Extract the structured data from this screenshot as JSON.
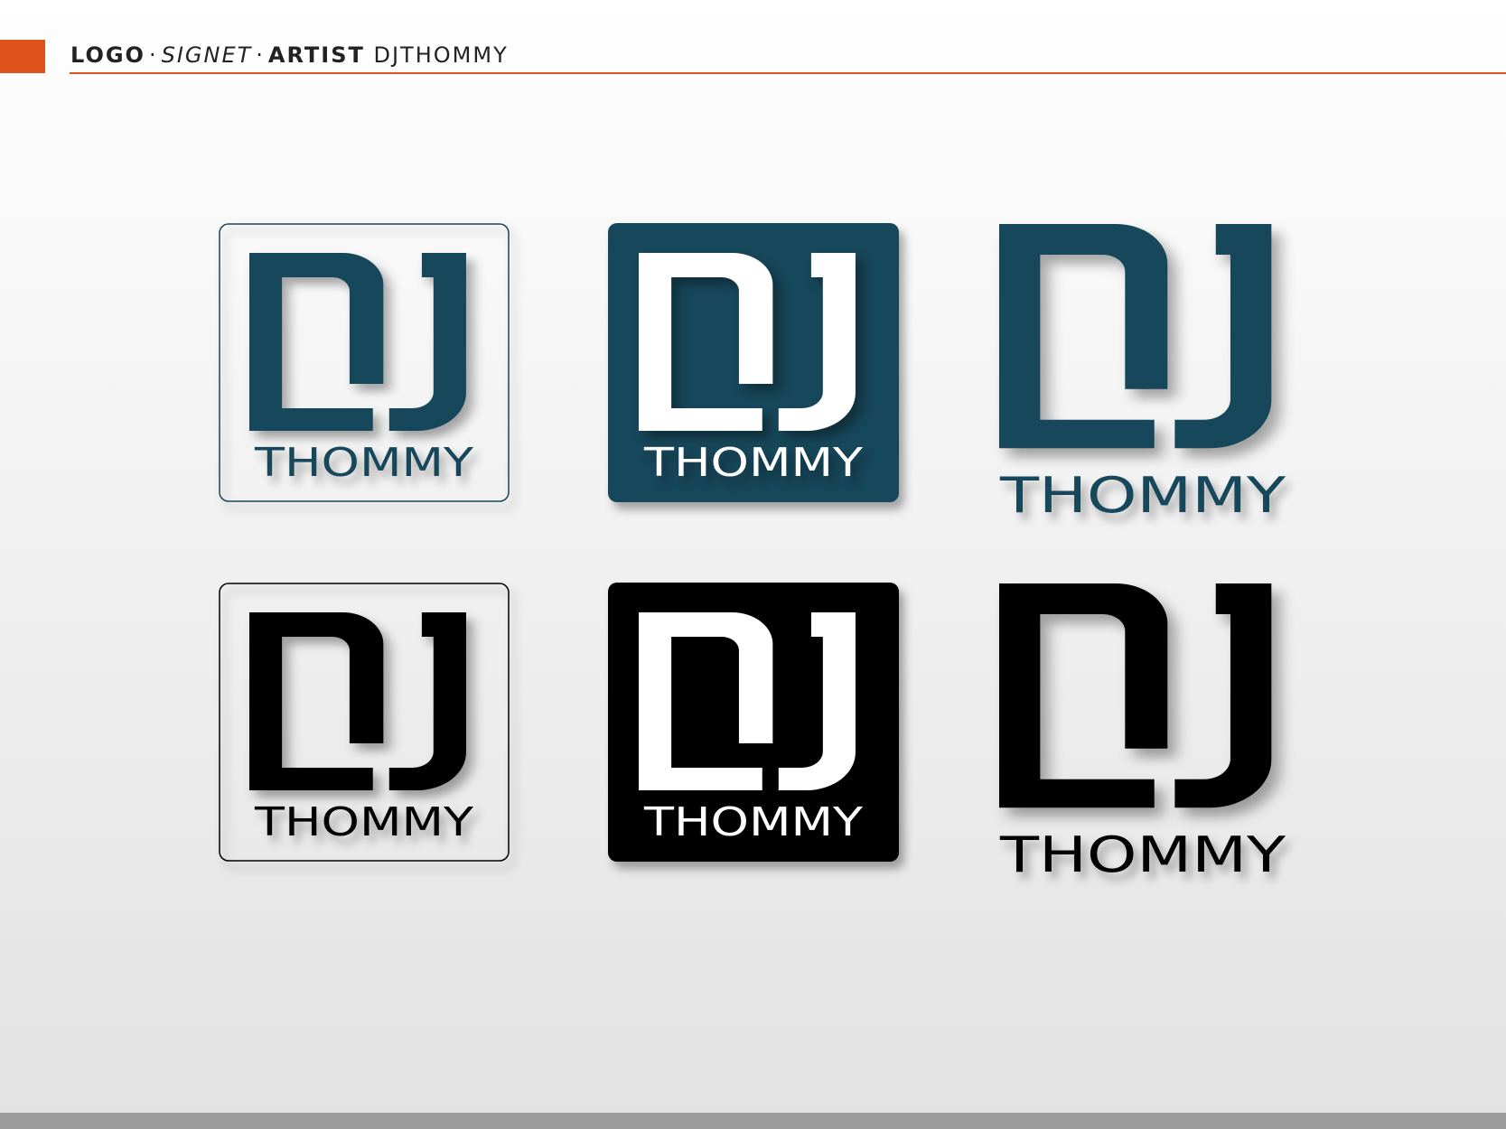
{
  "header": {
    "logo": "LOGO",
    "signet": "SIGNET",
    "artist": "ARTIST",
    "name": "DJTHOMMY",
    "separator": "·"
  },
  "colors": {
    "accent": "#e0521b",
    "brand_teal": "#17475a",
    "black": "#000000",
    "white": "#ffffff",
    "footer_gray": "#9c9c9c"
  },
  "logos": [
    {
      "id": "teal-outline",
      "style": "outline",
      "color": "#17475a",
      "wordmark": "THOMMY"
    },
    {
      "id": "teal-filled",
      "style": "filled",
      "color": "#17475a",
      "wordmark": "THOMMY"
    },
    {
      "id": "teal-plain",
      "style": "plain",
      "color": "#17475a",
      "wordmark": "THOMMY"
    },
    {
      "id": "black-outline",
      "style": "outline",
      "color": "#000000",
      "wordmark": "THOMMY"
    },
    {
      "id": "black-filled",
      "style": "filled",
      "color": "#000000",
      "wordmark": "THOMMY"
    },
    {
      "id": "black-plain",
      "style": "plain",
      "color": "#000000",
      "wordmark": "THOMMY"
    }
  ]
}
